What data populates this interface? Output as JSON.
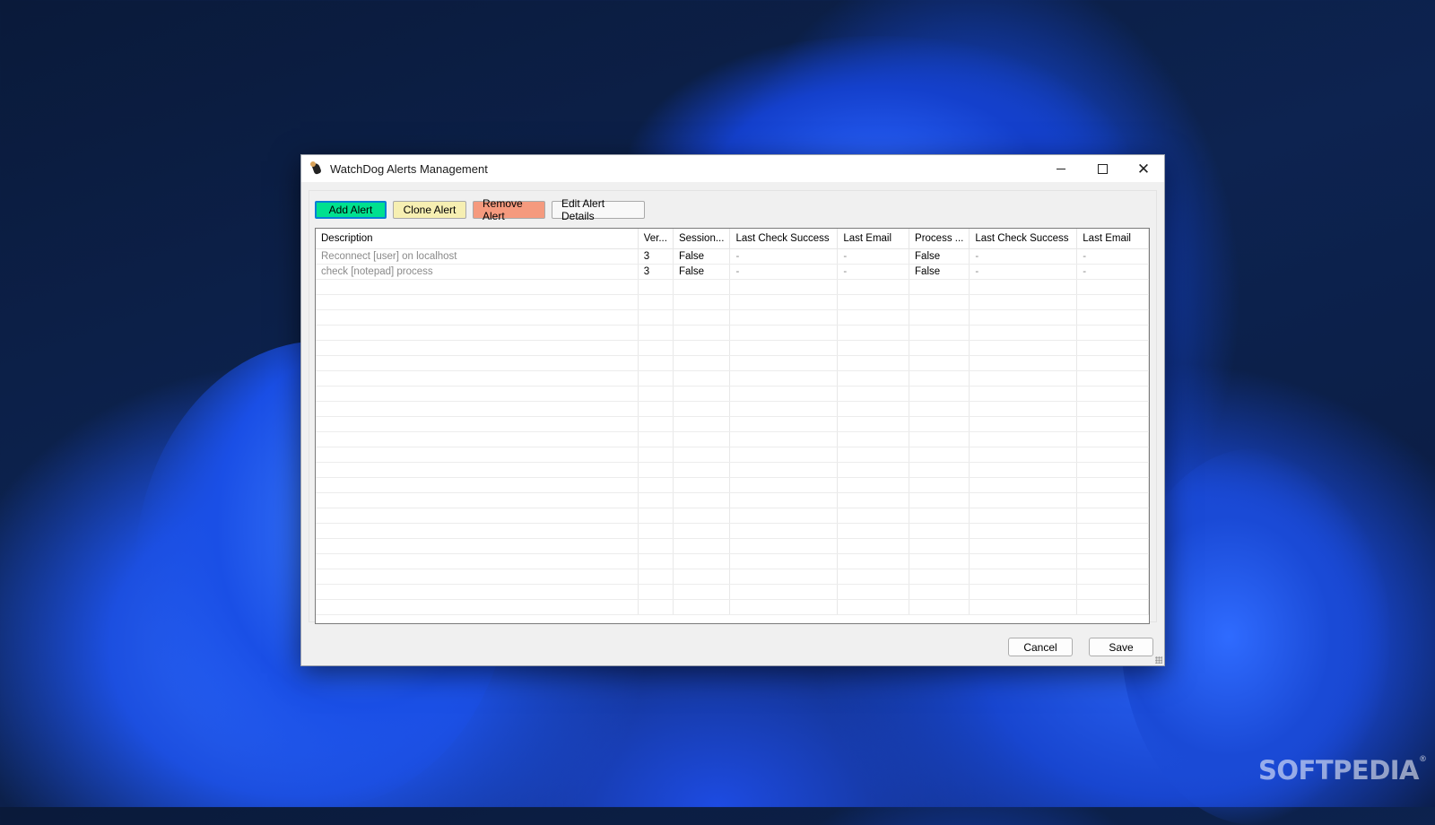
{
  "window": {
    "title": "WatchDog Alerts Management",
    "app_icon": "watchdog-dog-icon",
    "controls": {
      "minimize": "minimize-icon",
      "maximize": "maximize-icon",
      "close": "close-icon"
    }
  },
  "toolbar": {
    "add_label": "Add Alert",
    "clone_label": "Clone Alert",
    "remove_label": "Remove Alert",
    "edit_label": "Edit Alert Details",
    "colors": {
      "add": "#00e08f",
      "clone": "#f6efb2",
      "remove": "#f59a7e",
      "focus": "#0a7fd6"
    }
  },
  "grid": {
    "columns": [
      "Description",
      "Ver...",
      "Session...",
      "Last Check Success",
      "Last Email",
      "Process ...",
      "Last Check Success",
      "Last Email"
    ],
    "rows": [
      [
        "Reconnect [user] on localhost",
        "3",
        "False",
        "-",
        "-",
        "False",
        "-",
        "-"
      ],
      [
        "check [notepad] process",
        "3",
        "False",
        "-",
        "-",
        "False",
        "-",
        "-"
      ]
    ]
  },
  "footer": {
    "cancel_label": "Cancel",
    "save_label": "Save"
  },
  "watermark": {
    "text": "SOFTPEDIA",
    "mark": "®"
  }
}
